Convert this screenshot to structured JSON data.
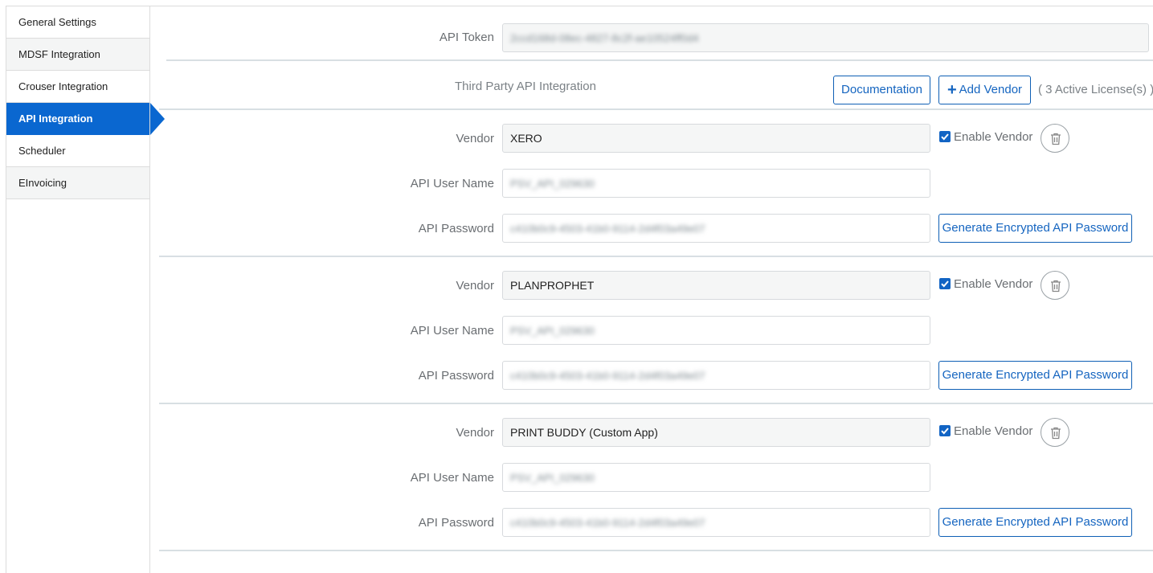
{
  "sidebar": {
    "items": [
      {
        "label": "General Settings"
      },
      {
        "label": "MDSF Integration"
      },
      {
        "label": "Crouser Integration"
      },
      {
        "label": "API Integration"
      },
      {
        "label": "Scheduler"
      },
      {
        "label": "EInvoicing"
      }
    ]
  },
  "api_token": {
    "label": "API Token",
    "value": "2ccd168d-08ec-4827-8c2f-ae10524ff0d4"
  },
  "third_party": {
    "title": "Third Party API Integration",
    "documentation_label": "Documentation",
    "add_vendor_label": "Add Vendor",
    "license_text": "( 3 Active License(s) )"
  },
  "vendors": [
    {
      "vendor_label": "Vendor",
      "vendor_value": "XERO",
      "enable_label": "Enable Vendor",
      "enabled": true,
      "user_label": "API User Name",
      "user_value": "PSV_API_029630",
      "password_label": "API Password",
      "password_value": "c410b0c9-4503-41b0-9114-2d4f03a49e07",
      "generate_label": "Generate Encrypted API Password"
    },
    {
      "vendor_label": "Vendor",
      "vendor_value": "PLANPROPHET",
      "enable_label": "Enable Vendor",
      "enabled": true,
      "user_label": "API User Name",
      "user_value": "PSV_API_029630",
      "password_label": "API Password",
      "password_value": "c410b0c9-4503-41b0-9114-2d4f03a49e07",
      "generate_label": "Generate Encrypted API Password"
    },
    {
      "vendor_label": "Vendor",
      "vendor_value": "PRINT BUDDY (Custom App)",
      "enable_label": "Enable Vendor",
      "enabled": true,
      "user_label": "API User Name",
      "user_value": "PSV_API_029630",
      "password_label": "API Password",
      "password_value": "c410b0c9-4503-41b0-9114-2d4f03a49e07",
      "generate_label": "Generate Encrypted API Password"
    }
  ],
  "icons": {
    "checkbox": "checkbox-checked-icon",
    "delete": "trash-icon",
    "add": "plus-icon"
  },
  "colors": {
    "accent": "#0a67d0",
    "button_text": "#1565c0"
  }
}
